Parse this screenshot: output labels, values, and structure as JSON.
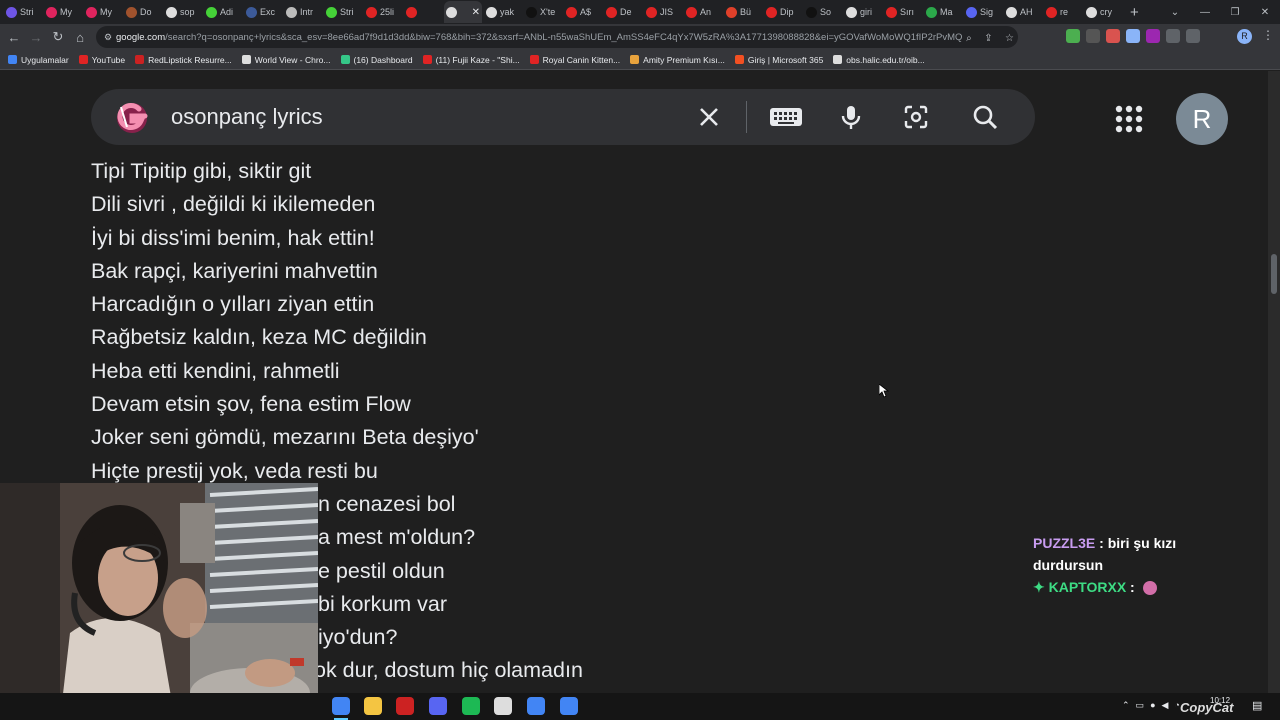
{
  "browser": {
    "tabs": [
      {
        "label": "Stri",
        "color": "#6e55e6"
      },
      {
        "label": "My",
        "color": "#e0245e"
      },
      {
        "label": "My",
        "color": "#e0245e"
      },
      {
        "label": "Do",
        "color": "#a0522d"
      },
      {
        "label": "sop",
        "color": "#dddddd"
      },
      {
        "label": "Adi",
        "color": "#45d138"
      },
      {
        "label": "Exc",
        "color": "#3c5a99"
      },
      {
        "label": "Intr",
        "color": "#bbbbbb"
      },
      {
        "label": "Stri",
        "color": "#45d138"
      },
      {
        "label": "25li",
        "color": "#e02424"
      },
      {
        "label": "",
        "color": "#e02424"
      },
      {
        "label": "",
        "color": "#dddddd",
        "active": true
      },
      {
        "label": "yak",
        "color": "#dddddd"
      },
      {
        "label": "X'te",
        "color": "#111111"
      },
      {
        "label": "A$",
        "color": "#e02424"
      },
      {
        "label": "De",
        "color": "#e02424"
      },
      {
        "label": "JIS",
        "color": "#e02424"
      },
      {
        "label": "An",
        "color": "#e02424"
      },
      {
        "label": "Bü",
        "color": "#e0402a"
      },
      {
        "label": "Dip",
        "color": "#e02424"
      },
      {
        "label": "So",
        "color": "#111111"
      },
      {
        "label": "giri",
        "color": "#dddddd"
      },
      {
        "label": "Sırı",
        "color": "#e02424"
      },
      {
        "label": "Ma",
        "color": "#2ba84a"
      },
      {
        "label": "Sig",
        "color": "#5865f2"
      },
      {
        "label": "AH",
        "color": "#dddddd"
      },
      {
        "label": "re",
        "color": "#e02424"
      },
      {
        "label": "cry",
        "color": "#dddddd"
      }
    ],
    "new_tab": "+",
    "url_host": "google.com",
    "url_rest": "/search?q=osonpanç+lyrics&sca_esv=8ee66ad7f9d1d3dd&biw=768&bih=372&sxsrf=ANbL-n55waShUEm_AmSS4eFC4qYx7W5zRA%3A1771398088828&ei=yGOVafWoMoWQ1fIP2rPvMQ&ved=0ahU...",
    "bookmarks": [
      {
        "label": "Uygulamalar",
        "color": "#4285f4"
      },
      {
        "label": "YouTube",
        "color": "#e02424"
      },
      {
        "label": "RedLipstick Resurre...",
        "color": "#cc2222"
      },
      {
        "label": "World View - Chro...",
        "color": "#dddddd"
      },
      {
        "label": "(16) Dashboard",
        "color": "#35c788"
      },
      {
        "label": "(11) Fujii Kaze - \"Shi...",
        "color": "#e02424"
      },
      {
        "label": "Royal Canin Kitten...",
        "color": "#e02424"
      },
      {
        "label": "Amity Premium Kısı...",
        "color": "#e8a33d"
      },
      {
        "label": "Giriş | Microsoft 365",
        "color": "#f25022"
      },
      {
        "label": "obs.halic.edu.tr/oib...",
        "color": "#dddddd"
      }
    ],
    "profile_initial": "R"
  },
  "search": {
    "query": "osonpanç lyrics",
    "avatar_initial": "R"
  },
  "lyrics": [
    "Tipi Tipitip gibi, siktir git",
    "Dili sivri , değildi ki ikilemeden",
    "İyi bi diss'imi benim, hak ettin!",
    "Bak rapçi, kariyerini mahvettin",
    "Harcadığın o yılları ziyan ettin",
    "Rağbetsiz kaldın, keza MC değildin",
    "Heba etti kendini, rahmetli",
    "Devam etsin şov, fena estim Flow",
    "Joker seni gömdü, mezarını Beta deşiyo'",
    "Hiçte prestij yok, veda resti bu",
    "n cenazesi bol",
    "a mest m'oldun?",
    "e pestil oldun",
    "bi korkum var",
    "iyo'dun?",
    "ok dur, dostum hiç olamadın"
  ],
  "chat": [
    {
      "user": "PUZZL3E",
      "text": "biri şu kızı durdursun",
      "color": "#c89cf0"
    },
    {
      "user": "KAPTORXX",
      "text": "",
      "color": "#3ddc84"
    }
  ],
  "taskbar": {
    "clock_time": "10:12",
    "apps": [
      {
        "name": "chrome",
        "color": "#4285f4"
      },
      {
        "name": "files",
        "color": "#f4c542"
      },
      {
        "name": "game",
        "color": "#cc2222"
      },
      {
        "name": "discord",
        "color": "#5865f2"
      },
      {
        "name": "spotify",
        "color": "#1db954"
      },
      {
        "name": "obs",
        "color": "#dddddd"
      },
      {
        "name": "chrome-2",
        "color": "#4285f4"
      },
      {
        "name": "chrome-3",
        "color": "#4285f4"
      }
    ]
  },
  "watermark": "CopyCat"
}
